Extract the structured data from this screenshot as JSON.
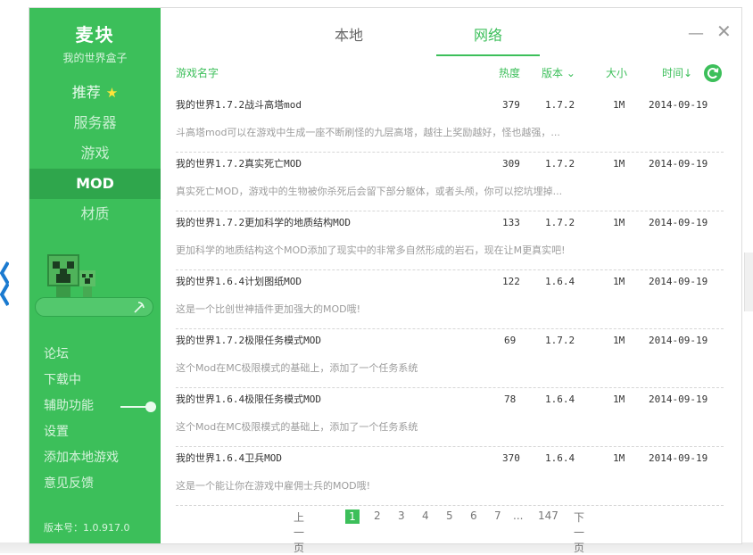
{
  "sidebar": {
    "brand_title": "麦块",
    "brand_subtitle": "我的世界盒子",
    "nav": [
      {
        "label": "推荐"
      },
      {
        "label": "服务器"
      },
      {
        "label": "游戏"
      },
      {
        "label": "MOD"
      },
      {
        "label": "材质"
      }
    ],
    "links": [
      "论坛",
      "下载中",
      "辅助功能",
      "设置",
      "添加本地游戏",
      "意见反馈"
    ],
    "version": "版本号：1.0.917.0"
  },
  "tabs": [
    "本地",
    "网络"
  ],
  "list_header": {
    "name": "游戏名字",
    "heat": "热度",
    "version": "版本",
    "size": "大小",
    "time": "时间↓"
  },
  "rows": [
    {
      "title": "我的世界1.7.2战斗高塔mod",
      "desc": "斗高塔mod可以在游戏中生成一座不断刷怪的九层高塔，越往上奖励越好，怪也越强，...",
      "heat": "379",
      "version": "1.7.2",
      "size": "1M",
      "date": "2014-09-19"
    },
    {
      "title": "我的世界1.7.2真实死亡MOD",
      "desc": "真实死亡MOD，游戏中的生物被你杀死后会留下部分躯体，或者头颅，你可以挖坑埋掉...",
      "heat": "309",
      "version": "1.7.2",
      "size": "1M",
      "date": "2014-09-19"
    },
    {
      "title": "我的世界1.7.2更加科学的地质结构MOD",
      "desc": "更加科学的地质结构这个MOD添加了现实中的非常多自然形成的岩石，现在让M更真实吧!",
      "heat": "133",
      "version": "1.7.2",
      "size": "1M",
      "date": "2014-09-19"
    },
    {
      "title": "我的世界1.6.4计划图纸MOD",
      "desc": "这是一个比创世神插件更加强大的MOD哦!",
      "heat": "122",
      "version": "1.6.4",
      "size": "1M",
      "date": "2014-09-19"
    },
    {
      "title": "我的世界1.7.2极限任务模式MOD",
      "desc": "这个Mod在MC极限模式的基础上，添加了一个任务系统",
      "heat": "69",
      "version": "1.7.2",
      "size": "1M",
      "date": "2014-09-19"
    },
    {
      "title": "我的世界1.6.4极限任务模式MOD",
      "desc": "这个Mod在MC极限模式的基础上，添加了一个任务系统",
      "heat": "78",
      "version": "1.6.4",
      "size": "1M",
      "date": "2014-09-19"
    },
    {
      "title": "我的世界1.6.4卫兵MOD",
      "desc": "这是一个能让你在游戏中雇佣士兵的MOD哦!",
      "heat": "370",
      "version": "1.6.4",
      "size": "1M",
      "date": "2014-09-19"
    }
  ],
  "pager": {
    "prev": "上一页",
    "pages": [
      "1",
      "2",
      "3",
      "4",
      "5",
      "6",
      "7"
    ],
    "ellipsis": "...",
    "last": "147",
    "next": "下一页"
  },
  "colors": {
    "accent": "#3cbf5a",
    "accent_dark": "#2fa64c",
    "star": "#ffe43a"
  }
}
